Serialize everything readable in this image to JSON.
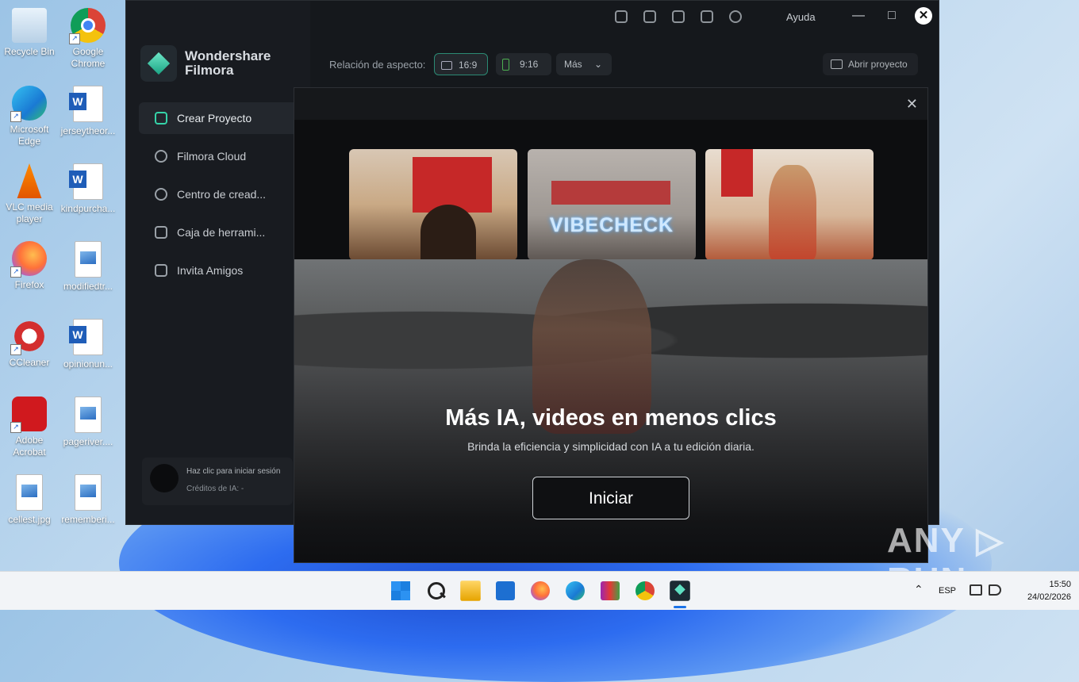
{
  "desktop": {
    "icons": [
      {
        "label": "Recycle Bin"
      },
      {
        "label": "Google Chrome"
      },
      {
        "label": "Microsoft Edge"
      },
      {
        "label": "jerseytheor..."
      },
      {
        "label": "VLC media player"
      },
      {
        "label": "kindpurcha..."
      },
      {
        "label": "Firefox"
      },
      {
        "label": "modifiedtr..."
      },
      {
        "label": "CCleaner"
      },
      {
        "label": "opinionun..."
      },
      {
        "label": "Adobe Acrobat"
      },
      {
        "label": "pageriver...."
      },
      {
        "label": "cellest.jpg"
      },
      {
        "label": "rememberi..."
      }
    ]
  },
  "app": {
    "brand": {
      "name_line1": "Wondershare",
      "name_line2": "Filmora"
    },
    "nav": [
      {
        "label": "Crear Proyecto",
        "icon": "plus-square-icon"
      },
      {
        "label": "Filmora Cloud",
        "icon": "cloud-icon"
      },
      {
        "label": "Centro de cread...",
        "icon": "bulb-icon"
      },
      {
        "label": "Caja de herrami...",
        "icon": "toolbox-icon"
      },
      {
        "label": "Invita Amigos",
        "icon": "gift-icon"
      }
    ],
    "login": {
      "prompt": "Haz clic para iniciar sesión",
      "credits": "Créditos de IA: -"
    },
    "topbar": {
      "help": "Ayuda"
    },
    "aspect": {
      "label": "Relación de aspecto:",
      "opt1": "16:9",
      "opt2": "9:16",
      "more": "Más"
    },
    "open_project": "Abrir proyecto"
  },
  "modal": {
    "thumb_text": "VIBECHECK",
    "headline": "Más IA, videos en menos clics",
    "subline": "Brinda la eficiencia y simplicidad con IA a tu edición diaria.",
    "start_label": "Iniciar",
    "close_symbol": "✕"
  },
  "watermark": "ANY ▷ RUN",
  "taskbar": {
    "lang": "ESP",
    "time": "15:50",
    "date": "24/02/2026"
  },
  "colors": {
    "accent": "#35d3a8",
    "modal_bg": "#0d0e10"
  }
}
